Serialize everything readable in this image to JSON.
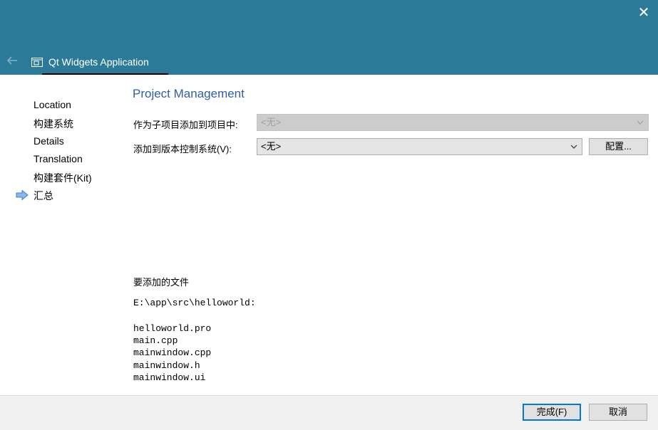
{
  "window": {
    "close_glyph": "✕",
    "back_glyph": "🡐",
    "wizard_title": "Qt Widgets Application"
  },
  "steps": [
    {
      "label": "Location"
    },
    {
      "label": "构建系统"
    },
    {
      "label": "Details"
    },
    {
      "label": "Translation"
    },
    {
      "label": "构建套件(Kit)"
    },
    {
      "label": "汇总",
      "current": true
    }
  ],
  "page": {
    "title": "Project Management",
    "subproject_label": "作为子项目添加到项目中:",
    "subproject_value": "<无>",
    "vcs_label": "添加到版本控制系统(V):",
    "vcs_value": "<无>",
    "configure_button": "配置...",
    "files_label": "要添加的文件",
    "files_dir": "E:\\app\\src\\helloworld:",
    "files": [
      "helloworld.pro",
      "main.cpp",
      "mainwindow.cpp",
      "mainwindow.h",
      "mainwindow.ui"
    ]
  },
  "footer": {
    "finish_button": "完成(F)",
    "cancel_button": "取消"
  },
  "colors": {
    "titlebar": "#2b7b98",
    "heading": "#2f5ea6",
    "default_button_border": "#0078d7"
  }
}
